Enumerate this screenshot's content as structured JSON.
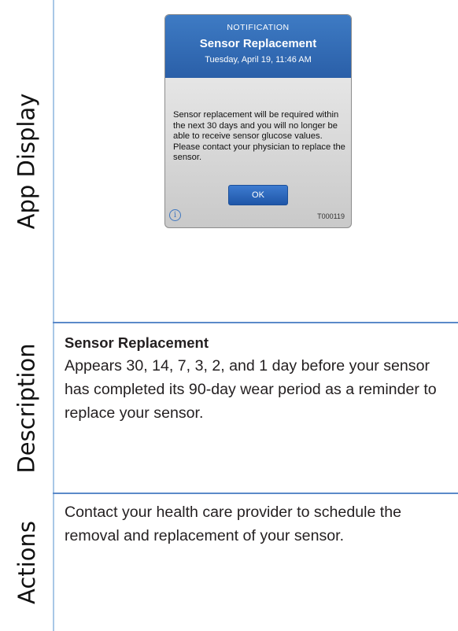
{
  "sections": {
    "app_display": "App Display",
    "description": "Description",
    "actions": "Actions"
  },
  "notification": {
    "kind": "NOTIFICATION",
    "title": "Sensor Replacement",
    "datetime": "Tuesday, April 19, 11:46 AM",
    "message": "Sensor replacement will be required within the next 30 days and you will no longer be able to receive sensor glucose values. Please contact your physician to replace the sensor.",
    "ok_label": "OK",
    "info_glyph": "i",
    "code": "T000119",
    "info_icon": "info-circle-icon",
    "header_color": "#2f69b3",
    "button_color": "#2a64b8"
  },
  "description": {
    "title": "Sensor Replacement",
    "body": "Appears 30, 14, 7, 3, 2, and 1 day before your sensor has completed its 90-day wear period as a reminder to replace your sensor."
  },
  "actions": {
    "body": "Contact your health care provider to schedule the removal and replacement of your sensor."
  },
  "colors": {
    "divider": "#5b8ac9"
  }
}
